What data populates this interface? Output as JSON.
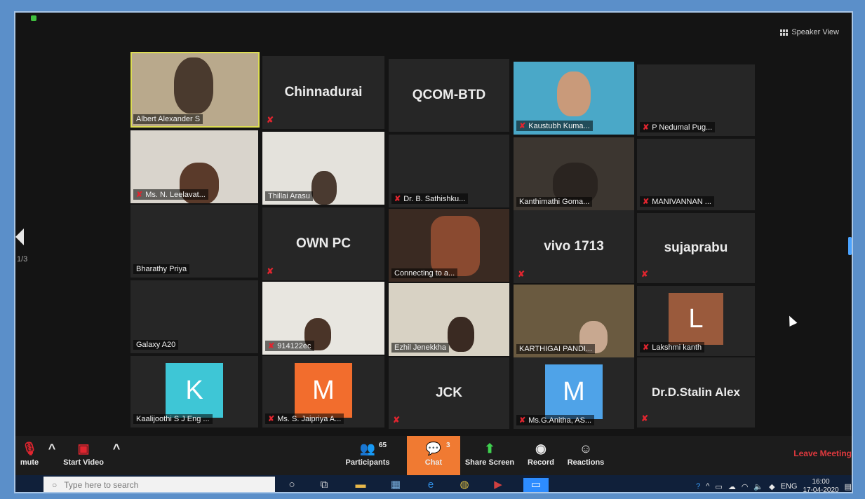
{
  "view": {
    "speaker_view_label": "Speaker View",
    "page_indicator": "1/3"
  },
  "tiles": {
    "albert": "Albert Alexander S",
    "chinnadurai": "Chinnadurai",
    "qcom": "QCOM-BTD",
    "kaustubh": "Kaustubh Kuma...",
    "nedumal": "P Nedumal Pug...",
    "leelavat": "Ms. N. Leelavat...",
    "thillai": "Thillai Arasu",
    "sathishku": "Dr. B. Sathishku...",
    "kanthimathi": "Kanthimathi Goma...",
    "manivannan": "MANIVANNAN ...",
    "bharathy": "Bharathy Priya",
    "ownpc": "OWN PC",
    "connecting": "Connecting to a...",
    "vivo": "vivo 1713",
    "sujaprabu": "sujaprabu",
    "galaxy": "Galaxy A20",
    "p14122ec": "914122ec",
    "ezhil": "Ezhil Jenekkha",
    "karthigai": "KARTHIGAI PANDI...",
    "lakshmi": "Lakshmi kanth",
    "lakshmi_initial": "L",
    "kaalijoothi": "Kaalijoothi S J Eng ...",
    "kaalijoothi_initial": "K",
    "jaipriya": "Ms. S. Jaipriya A...",
    "jaipriya_initial": "M",
    "jck": "JCK",
    "anitha": "Ms.G.Anitha, AS...",
    "anitha_initial": "M",
    "stalin": "Dr.D.Stalin Alex"
  },
  "toolbar": {
    "mute": "mute",
    "start_video": "Start Video",
    "participants": "Participants",
    "participants_count": "65",
    "chat": "Chat",
    "chat_count": "3",
    "share": "Share Screen",
    "record": "Record",
    "reactions": "Reactions",
    "leave": "Leave Meeting"
  },
  "taskbar": {
    "search_placeholder": "Type here to search",
    "lang": "ENG",
    "time": "16:00",
    "date": "17-04-2020"
  },
  "colors": {
    "chat_accent": "#f07a32",
    "avatar_teal": "#3ec6d6",
    "avatar_orange": "#f26d2d",
    "avatar_blue": "#4fa3e8",
    "avatar_brown": "#9a5a3c",
    "muted_red": "#e0252f",
    "leave_red": "#e0393e"
  }
}
